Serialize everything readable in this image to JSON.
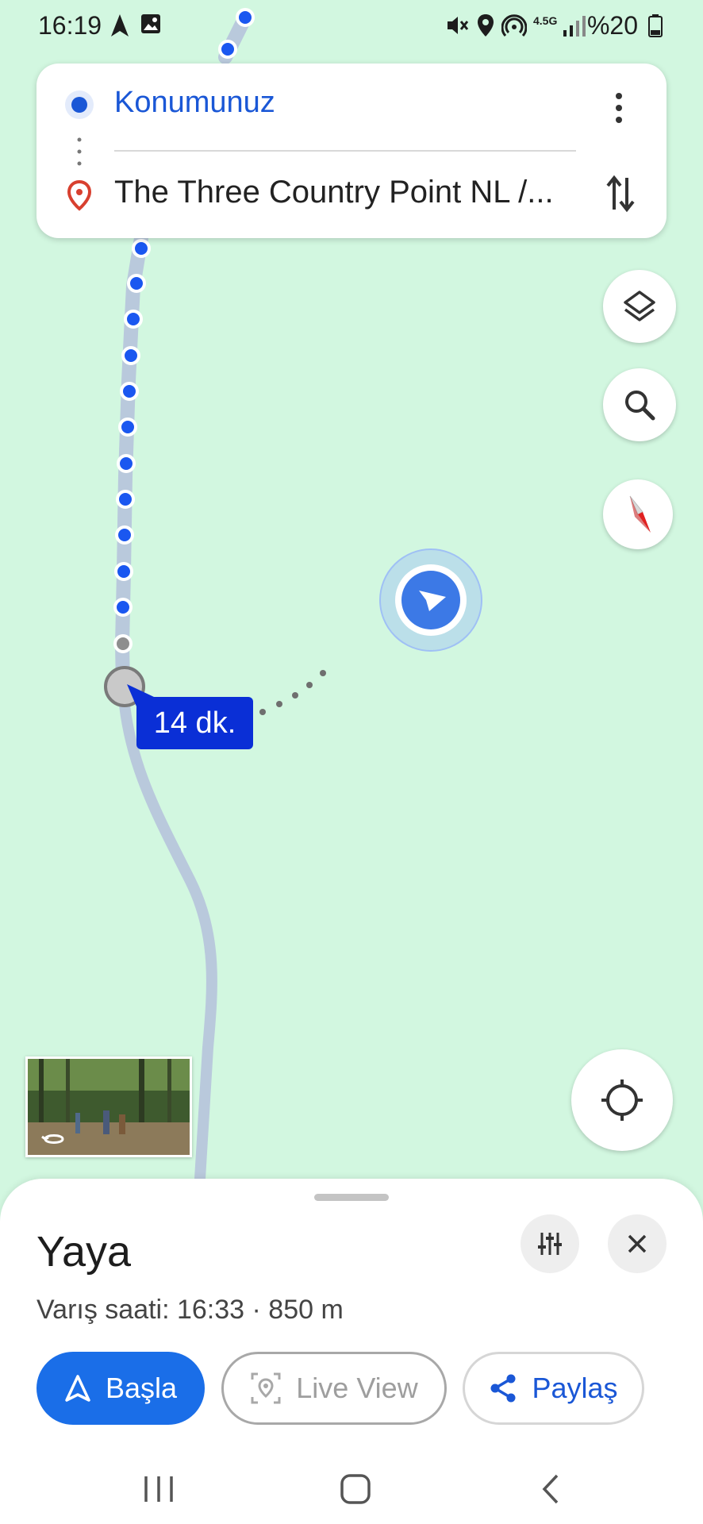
{
  "status_bar": {
    "time": "16:19",
    "network": "4.5G",
    "battery": "%20",
    "icons": [
      "navigation-arrow-icon",
      "image-icon",
      "mute-icon",
      "location-icon",
      "hotspot-icon",
      "signal-icon",
      "battery-icon"
    ]
  },
  "route_card": {
    "origin": "Konumunuz",
    "destination": "The Three Country Point NL /..."
  },
  "map": {
    "duration_label": "14 dk.",
    "route_color": "#1a57f0",
    "walking_path_color": "#b9c9dc"
  },
  "sheet": {
    "mode_title": "Yaya",
    "arrival_info": "Varış saati: 16:33 · 850 m",
    "start_label": "Başla",
    "live_view_label": "Live View",
    "share_label": "Paylaş"
  },
  "colors": {
    "accent": "#1a6ee8",
    "map_bg": "#d2f7e0",
    "badge": "#0a2fd6"
  }
}
